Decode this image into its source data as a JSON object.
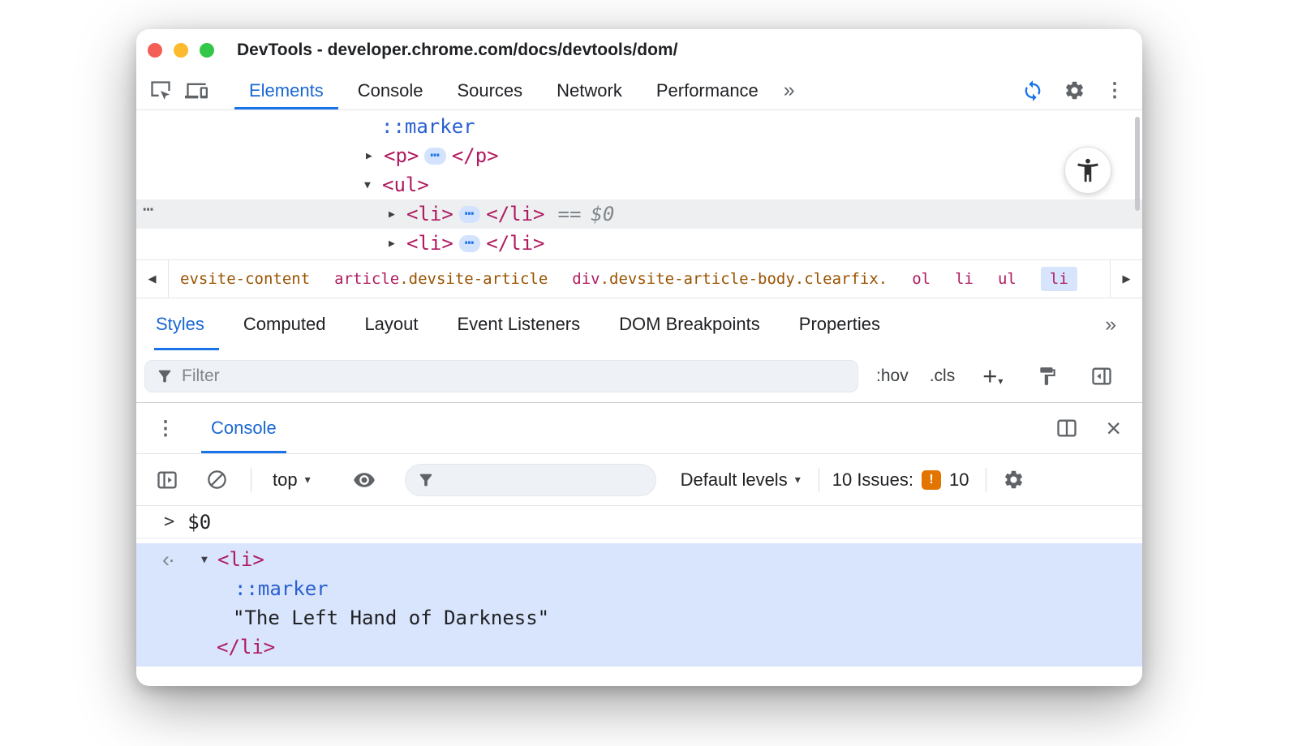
{
  "window": {
    "title": "DevTools - developer.chrome.com/docs/devtools/dom/"
  },
  "icons": {
    "kebab_vertical": "⋮",
    "close": "×",
    "chevron_double": "»",
    "caret_down": "▾",
    "twisty_collapsed": "▶",
    "twisty_expanded": "▼",
    "arrow_left": "◀",
    "arrow_right": "▶",
    "ellipsis": "⋯",
    "return_value": "‹·",
    "prompt_chevron": ">"
  },
  "main_toolbar": {
    "tabs": [
      {
        "label": "Elements",
        "active": true
      },
      {
        "label": "Console",
        "active": false
      },
      {
        "label": "Sources",
        "active": false
      },
      {
        "label": "Network",
        "active": false
      },
      {
        "label": "Performance",
        "active": false
      }
    ]
  },
  "dom_tree": {
    "marker_row": {
      "text": "::marker"
    },
    "p_row": {
      "open": "<p>",
      "close": "</p>"
    },
    "ul_row": {
      "open": "<ul>"
    },
    "li_selected_row": {
      "open": "<li>",
      "close": "</li>",
      "equals": "==",
      "var": "$0"
    },
    "li_row": {
      "open": "<li>",
      "close": "</li>"
    }
  },
  "breadcrumbs": {
    "items": [
      {
        "element": "",
        "classes": "evsite-content",
        "selected": false
      },
      {
        "element": "article",
        "classes": ".devsite-article",
        "selected": false
      },
      {
        "element": "div",
        "classes": ".devsite-article-body.clearfix.",
        "selected": false
      },
      {
        "element": "ol",
        "classes": "",
        "selected": false
      },
      {
        "element": "li",
        "classes": "",
        "selected": false
      },
      {
        "element": "ul",
        "classes": "",
        "selected": false
      },
      {
        "element": "li",
        "classes": "",
        "selected": true
      }
    ]
  },
  "sidebar_tabs": {
    "tabs": [
      {
        "label": "Styles",
        "active": true
      },
      {
        "label": "Computed",
        "active": false
      },
      {
        "label": "Layout",
        "active": false
      },
      {
        "label": "Event Listeners",
        "active": false
      },
      {
        "label": "DOM Breakpoints",
        "active": false
      },
      {
        "label": "Properties",
        "active": false
      }
    ]
  },
  "styles_filter": {
    "placeholder": "Filter",
    "hov": ":hov",
    "cls": ".cls",
    "plus": "+"
  },
  "drawer": {
    "tab": "Console"
  },
  "console_toolbar": {
    "context": "top",
    "levels": "Default levels",
    "filter_placeholder": "",
    "issues_label": "10 Issues:",
    "issues_badge": "!",
    "issues_count": "10"
  },
  "console": {
    "echo_value": "$0",
    "result": {
      "open": "<li>",
      "marker": "::marker",
      "text": "\"The Left Hand of Darkness\"",
      "close": "</li>"
    }
  },
  "colors": {
    "accent_blue": "#1a73e8",
    "active_tab_blue": "#1967d2",
    "code_tag_color": "#b01b60",
    "code_pseudo_blue": "#2a5fd1",
    "code_class_orange": "#9a5200",
    "dom_selected_row_bg": "#edeff1",
    "console_selection_bg": "#d8e5fc",
    "issues_orange": "#e37400"
  }
}
